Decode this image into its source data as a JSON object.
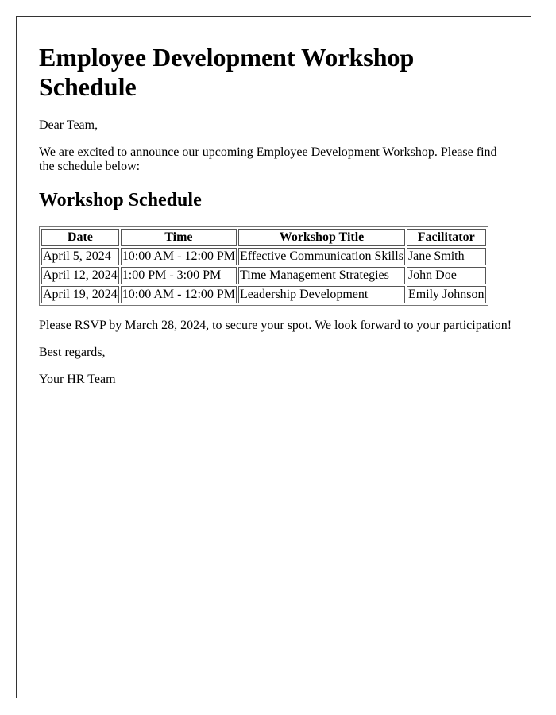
{
  "document": {
    "title": "Employee Development Workshop Schedule",
    "greeting": "Dear Team,",
    "intro": "We are excited to announce our upcoming Employee Development Workshop. Please find the schedule below:",
    "section_heading": "Workshop Schedule",
    "table": {
      "headers": [
        "Date",
        "Time",
        "Workshop Title",
        "Facilitator"
      ],
      "rows": [
        [
          "April 5, 2024",
          "10:00 AM - 12:00 PM",
          "Effective Communication Skills",
          "Jane Smith"
        ],
        [
          "April 12, 2024",
          "1:00 PM - 3:00 PM",
          "Time Management Strategies",
          "John Doe"
        ],
        [
          "April 19, 2024",
          "10:00 AM - 12:00 PM",
          "Leadership Development",
          "Emily Johnson"
        ]
      ]
    },
    "rsvp": "Please RSVP by March 28, 2024, to secure your spot. We look forward to your participation!",
    "closing": "Best regards,",
    "signature": "Your HR Team"
  }
}
